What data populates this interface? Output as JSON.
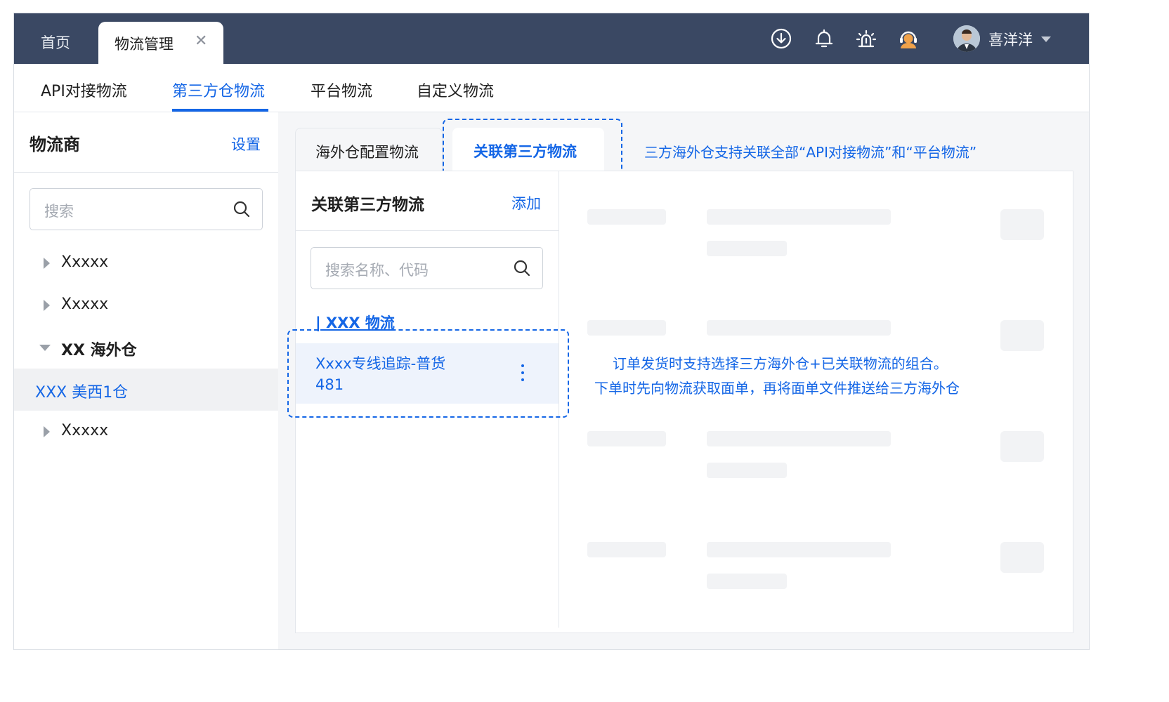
{
  "topbar": {
    "tab_home": "首页",
    "tab_active": "物流管理",
    "tab_close": "✕",
    "icons": [
      "download-icon",
      "bell-icon",
      "alarm-icon",
      "support-icon"
    ],
    "user_name": "喜洋洋"
  },
  "subtabs": [
    "API对接物流",
    "第三方仓物流",
    "平台物流",
    "自定义物流"
  ],
  "left": {
    "title": "物流商",
    "setting": "设置",
    "search_placeholder": "搜索",
    "tree": [
      {
        "label": "Xxxxx"
      },
      {
        "label": "Xxxxx"
      },
      {
        "label": "XX 海外仓"
      },
      {
        "label": "XXX 美西1仓"
      },
      {
        "label": "Xxxxx"
      }
    ]
  },
  "inner_tabs": [
    "海外仓配置物流",
    "关联第三方物流"
  ],
  "note_top": "三方海外仓支持关联全部“API对接物流”和“平台物流”",
  "middle": {
    "title": "关联第三方物流",
    "add": "添加",
    "search_placeholder": "搜索名称、代码",
    "group_title": "| XXX 物流",
    "item": {
      "name": "Xxxx专线追踪-普货",
      "code": "481"
    }
  },
  "note_mid": {
    "line1": "订单发货时支持选择三方海外仓+已关联物流的组合。",
    "line2": "下单时先向物流获取面单，再将面单文件推送给三方海外仓"
  },
  "colors": {
    "accent": "#1466e6",
    "topbar": "#3a4863"
  }
}
